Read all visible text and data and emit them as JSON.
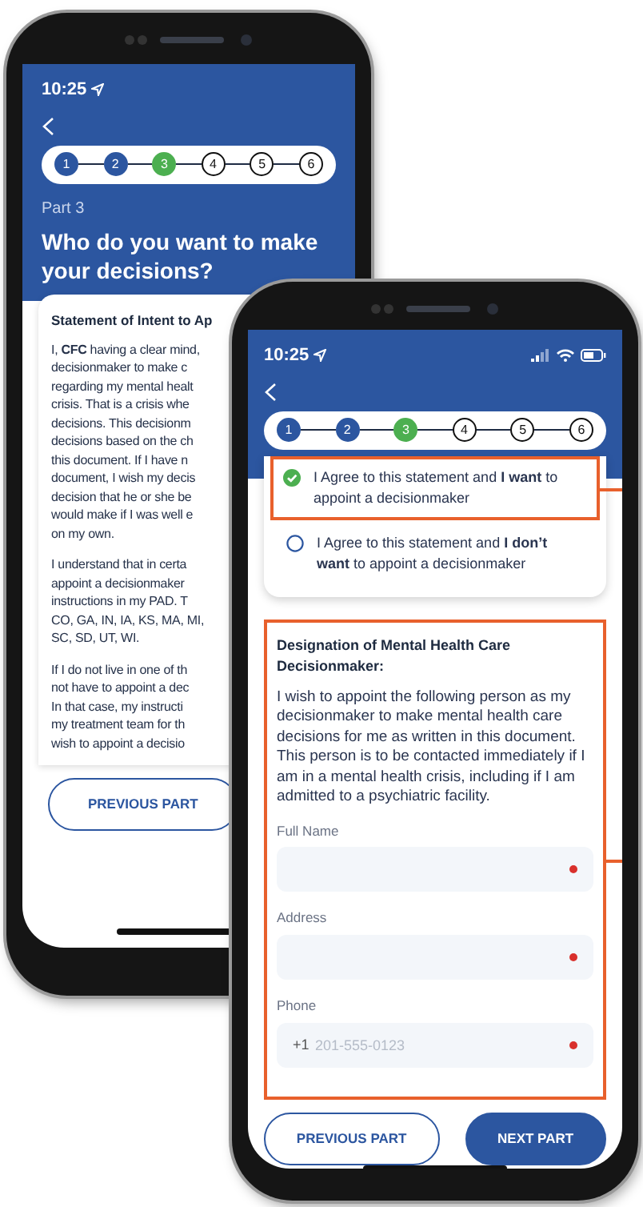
{
  "back_phone": {
    "status_time": "10:25",
    "steps": [
      {
        "number": "1",
        "kind": "done"
      },
      {
        "number": "2",
        "kind": "done"
      },
      {
        "number": "3",
        "kind": "current"
      },
      {
        "number": "4",
        "kind": "todo"
      },
      {
        "number": "5",
        "kind": "todo"
      },
      {
        "number": "6",
        "kind": "todo"
      }
    ],
    "part_label": "Part 3",
    "title": "Who do you want to make your decisions?",
    "statement": {
      "heading": "Statement of Intent to Ap",
      "paragraphs": [
        [
          "I, **CFC** having a clear mind,",
          "decisionmaker to make c",
          "regarding my mental healt",
          "crisis. That is a crisis whe",
          "decisions. This decisionm",
          "decisions based on the ch",
          "this document. If I have n",
          "document, I wish my decis",
          "decision that he or she be",
          "would make if I was well e",
          "on my own."
        ],
        [
          "I understand that in certa",
          "appoint a decisionmaker",
          "instructions in my PAD. T",
          "CO, GA, IN, IA, KS, MA, MI,",
          "SC, SD, UT, WI."
        ],
        [
          "If I do not live in one of th",
          "not have to appoint a dec",
          "In that case, my instructi",
          "my treatment team for th",
          "wish to appoint a decisio"
        ]
      ]
    },
    "buttons": [
      {
        "label": "PREVIOUS PART",
        "kind": "outline"
      }
    ]
  },
  "front_phone": {
    "status_time": "10:25",
    "steps": [
      {
        "number": "1",
        "kind": "done"
      },
      {
        "number": "2",
        "kind": "done"
      },
      {
        "number": "3",
        "kind": "current"
      },
      {
        "number": "4",
        "kind": "todo"
      },
      {
        "number": "5",
        "kind": "todo"
      },
      {
        "number": "6",
        "kind": "todo"
      }
    ],
    "options": [
      {
        "text": "I Agree to this statement and **I want** to appoint a decisionmaker",
        "selected": true
      },
      {
        "text": "I Agree to this statement and **I don’t want** to appoint a decisionmaker",
        "selected": false
      }
    ],
    "designation": {
      "heading": "Designation of Mental Health Care Decisionmaker:",
      "text": "I wish to appoint the following person as my decisionmaker to make mental health care decisions for me as written in this document. This person is to be contacted immediately if I am in a mental health crisis, including if I am admitted to a psychiatric facility.",
      "fields": [
        {
          "label": "Full Name",
          "required": true
        },
        {
          "label": "Address",
          "required": true
        },
        {
          "label": "Phone",
          "prefix": "+1",
          "placeholder": "201-555-0123",
          "required": true
        }
      ]
    },
    "buttons": [
      {
        "label": "PREVIOUS PART",
        "kind": "outline"
      },
      {
        "label": "NEXT PART",
        "kind": "primary"
      }
    ]
  }
}
